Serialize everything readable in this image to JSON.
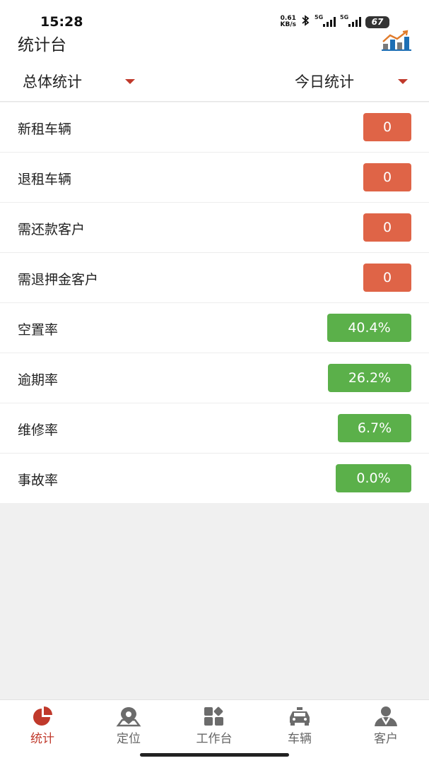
{
  "status_bar": {
    "time": "15:28",
    "net_speed_value": "0.61",
    "net_speed_unit": "KB/s",
    "signal_1": "5G",
    "signal_2": "5G",
    "battery": "67"
  },
  "header": {
    "title": "统计台",
    "chart_icon": "chart-icon"
  },
  "filters": {
    "left": {
      "label": "总体统计"
    },
    "right": {
      "label": "今日统计"
    }
  },
  "rows": [
    {
      "label": "新租车辆",
      "value": "0"
    },
    {
      "label": "退租车辆",
      "value": "0"
    },
    {
      "label": "需还款客户",
      "value": "0"
    },
    {
      "label": "需退押金客户",
      "value": "0"
    },
    {
      "label": "空置率",
      "value": "40.4%"
    },
    {
      "label": "逾期率",
      "value": "26.2%"
    },
    {
      "label": "维修率",
      "value": "6.7%"
    },
    {
      "label": "事故率",
      "value": "0.0%"
    }
  ],
  "colors": {
    "accent": "#c0392b",
    "count_badge": "#df6447",
    "rate_badge": "#5bb04a"
  },
  "tabs": [
    {
      "label": "统计",
      "icon": "pie-chart-icon",
      "active": true
    },
    {
      "label": "定位",
      "icon": "location-pin-icon",
      "active": false
    },
    {
      "label": "工作台",
      "icon": "workbench-icon",
      "active": false
    },
    {
      "label": "车辆",
      "icon": "car-icon",
      "active": false
    },
    {
      "label": "客户",
      "icon": "customer-icon",
      "active": false
    }
  ]
}
